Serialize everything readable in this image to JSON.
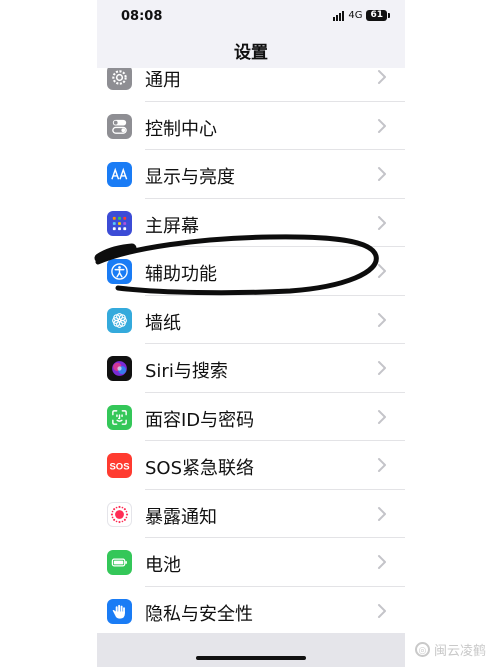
{
  "status_bar": {
    "time": "08:08",
    "network": "4G",
    "battery": "61"
  },
  "nav": {
    "title": "设置"
  },
  "settings": [
    {
      "label": "通用",
      "icon": "gear-icon",
      "color": "#8e8e93"
    },
    {
      "label": "控制中心",
      "icon": "toggle-icon",
      "color": "#8e8e93"
    },
    {
      "label": "显示与亮度",
      "icon": "text-size-icon",
      "color": "#1a7cf5"
    },
    {
      "label": "主屏幕",
      "icon": "home-grid-icon",
      "color": "#3c4cd6"
    },
    {
      "label": "辅助功能",
      "icon": "accessibility-icon",
      "color": "#1a7cf5"
    },
    {
      "label": "墙纸",
      "icon": "flower-icon",
      "color": "#34aadc"
    },
    {
      "label": "Siri与搜索",
      "icon": "siri-icon",
      "color": "#111111"
    },
    {
      "label": "面容ID与密码",
      "icon": "face-id-icon",
      "color": "#34c759"
    },
    {
      "label": "SOS紧急联络",
      "icon": "sos-icon",
      "color": "#ff3b30"
    },
    {
      "label": "暴露通知",
      "icon": "exposure-icon",
      "color": "#ffffff"
    },
    {
      "label": "电池",
      "icon": "battery-icon",
      "color": "#34c759"
    },
    {
      "label": "隐私与安全性",
      "icon": "hand-icon",
      "color": "#1a7cf5"
    }
  ],
  "watermark": {
    "text": "闽云凌鹤"
  }
}
